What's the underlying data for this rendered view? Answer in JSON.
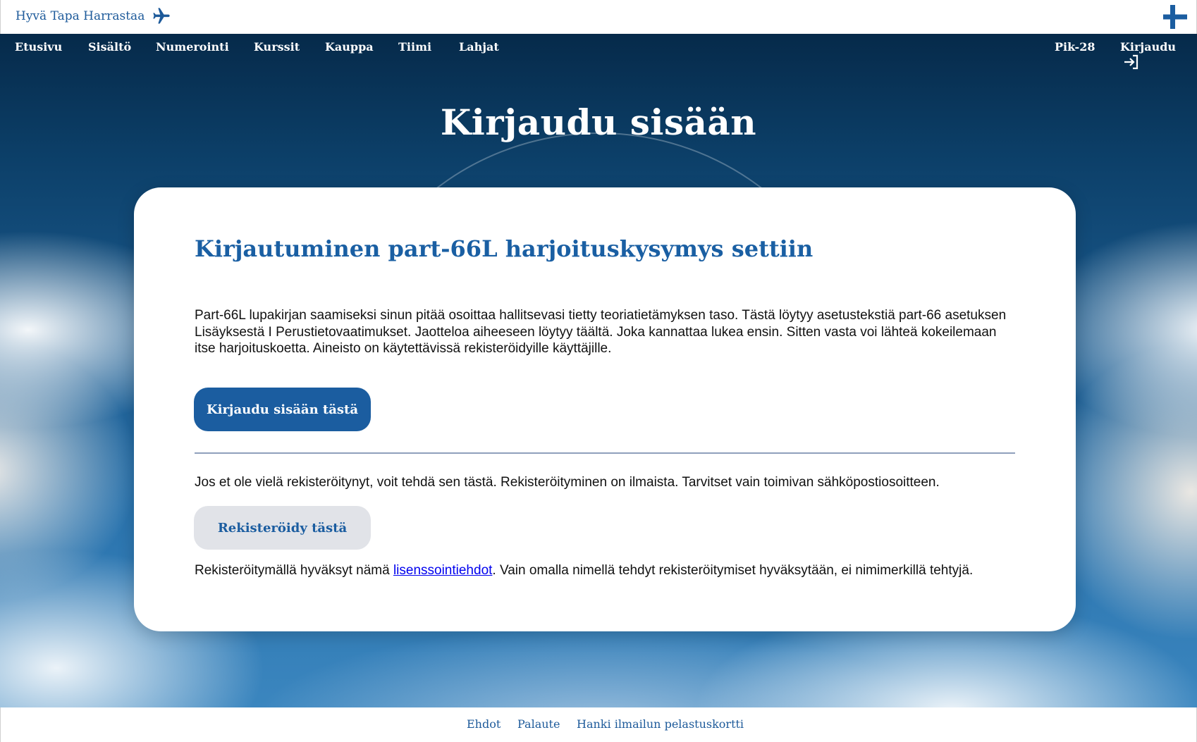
{
  "header": {
    "brand_label": "Hyvä Tapa Harrastaa",
    "brand_icon": "airplane-icon",
    "flag_icon": "finnish-flag-icon"
  },
  "nav": {
    "items": [
      "Etusivu",
      "Sisältö",
      "Numerointi",
      "Kurssit",
      "Kauppa",
      "Tiimi",
      "Lahjat"
    ],
    "right_items": [
      "Pik-28",
      "Kirjaudu"
    ],
    "login_icon": "login-arrow-icon"
  },
  "hero": {
    "title": "Kirjaudu sisään"
  },
  "card": {
    "heading": "Kirjautuminen part-66L harjoituskysymys settiin",
    "intro": "Part-66L lupakirjan saamiseksi sinun pitää osoittaa hallitsevasi tietty teoriatietämyksen taso. Tästä löytyy asetustekstiä part-66 asetuksen Lisäyksestä I Perustietovaatimukset. Jaotteloa aiheeseen löytyy täältä. Joka kannattaa lukea ensin. Sitten vasta voi lähteä kokeilemaan itse harjoituskoetta. Aineisto on käytettävissä rekisteröidyille käyttäjille.",
    "login_button": "Kirjaudu sisään tästä",
    "register_text": "Jos et ole vielä rekisteröitynyt, voit tehdä sen tästä. Rekisteröityminen on ilmaista. Tarvitset vain toimivan sähköpostiosoitteen.",
    "register_button": "Rekisteröidy tästä",
    "license_prefix": "Rekisteröitymällä hyväksyt nämä ",
    "license_link": "lisenssointiehdot",
    "license_suffix": ". Vain omalla nimellä tehdyt rekisteröitymiset hyväksytään, ei nimimerkillä tehtyjä."
  },
  "footer": {
    "links": [
      "Ehdot",
      "Palaute",
      "Hanki ilmailun pelastuskortti"
    ]
  },
  "colors": {
    "accent": "#1b5da0",
    "link": "#0000ee",
    "secondary_button": "#e1e3e8"
  }
}
